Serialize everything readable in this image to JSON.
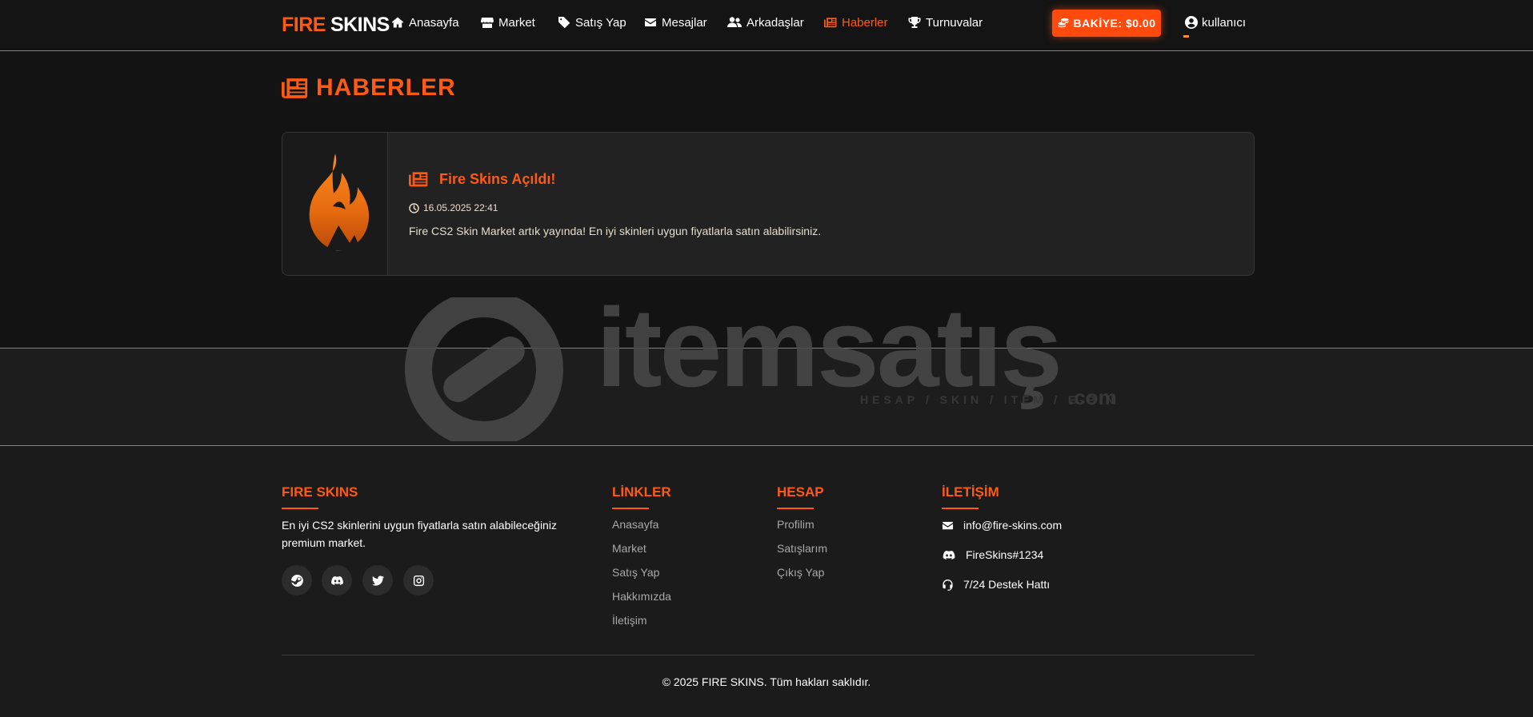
{
  "brand": {
    "part1": "FIRE",
    "part2": "SKINS"
  },
  "nav": {
    "items": [
      {
        "label": "Anasayfa",
        "icon": "home-icon"
      },
      {
        "label": "Market",
        "icon": "store-icon"
      },
      {
        "label": "Satış Yap",
        "icon": "tag-icon"
      },
      {
        "label": "Mesajlar",
        "icon": "envelope-icon"
      },
      {
        "label": "Arkadaşlar",
        "icon": "users-icon"
      },
      {
        "label": "Haberler",
        "icon": "newspaper-icon",
        "active": true
      },
      {
        "label": "Turnuvalar",
        "icon": "trophy-icon"
      }
    ],
    "balance_label": "BAKİYE: $0.00",
    "username": "kullanıcı"
  },
  "page": {
    "title": "HABERLER"
  },
  "news": [
    {
      "title": "Fire Skins Açıldı!",
      "date": "16.05.2025 22:41",
      "body": "Fire CS2 Skin Market artık yayında! En iyi skinleri uygun fiyatlarla satın alabilirsiniz."
    }
  ],
  "watermark": {
    "word": "itemsatış",
    "sub": "HESAP / SKIN / ITEM / E-PIN",
    "suffix": ".com"
  },
  "footer": {
    "about": {
      "heading": "FIRE SKINS",
      "text": "En iyi CS2 skinlerini uygun fiyatlarla satın alabileceğiniz premium market.",
      "socials": [
        "steam-icon",
        "discord-icon",
        "twitter-icon",
        "instagram-icon"
      ]
    },
    "links": {
      "heading": "LİNKLER",
      "items": [
        "Anasayfa",
        "Market",
        "Satış Yap",
        "Hakkımızda",
        "İletişim"
      ]
    },
    "account": {
      "heading": "HESAP",
      "items": [
        "Profilim",
        "Satışlarım",
        "Çıkış Yap"
      ]
    },
    "contact": {
      "heading": "İLETİŞİM",
      "email": "info@fire-skins.com",
      "discord": "FireSkins#1234",
      "support": "7/24 Destek Hattı"
    },
    "copyright": "© 2025 FIRE SKINS. Tüm hakları saklıdır."
  },
  "colors": {
    "accent": "#ff5a14",
    "background": "#131313",
    "card": "#222222"
  }
}
